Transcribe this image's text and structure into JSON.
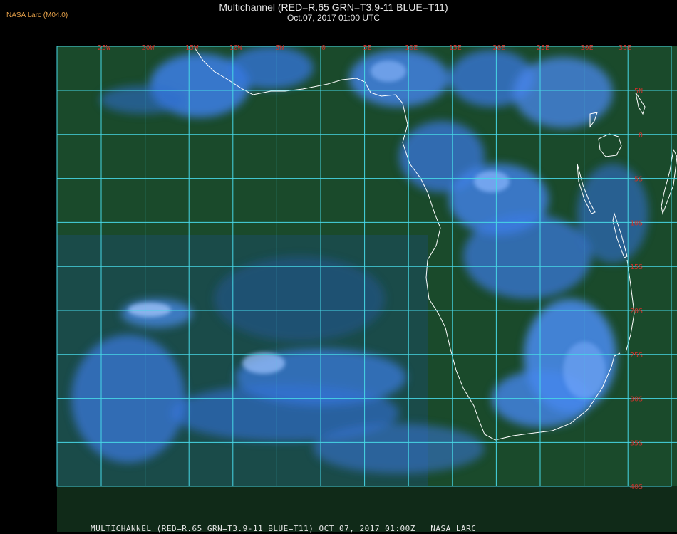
{
  "header": {
    "organization": "NASA Larc (M04.0)",
    "title": "Multichannel (RED=R.65 GRN=T3.9-11 BLUE=T11)",
    "datetime": "Oct.07, 2017 01:00 UTC"
  },
  "footer": {
    "text": "MULTICHANNEL (RED=R.65 GRN=T3.9-11 BLUE=T11) OCT 07, 2017 01:00Z   NASA LARC"
  },
  "map": {
    "longitude_labels": [
      "25W",
      "20W",
      "15W",
      "10W",
      "5W",
      "0",
      "5E",
      "10E",
      "15E",
      "20E",
      "25E",
      "30E",
      "35E"
    ],
    "latitude_labels": [
      "5N",
      "0",
      "5S",
      "10S",
      "15S",
      "20S",
      "25S",
      "30S",
      "35S",
      "40S"
    ],
    "colors": {
      "ocean": "#1b4a2c",
      "cloud": "#3a7df0",
      "grid": "#47d7e6",
      "coast": "#ffffff",
      "label": "#c8322a"
    }
  }
}
